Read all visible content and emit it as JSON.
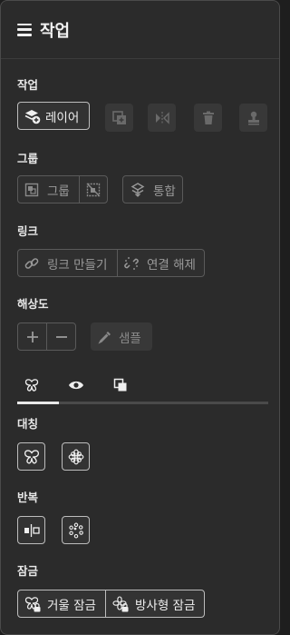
{
  "header": {
    "title": "작업"
  },
  "sections": {
    "work": {
      "label": "작업",
      "layer_button": "레이어"
    },
    "group": {
      "label": "그룹",
      "group_button": "그룹",
      "merge_button": "통합"
    },
    "link": {
      "label": "링크",
      "make_link_button": "링크 만들기",
      "unlink_button": "연결 해제"
    },
    "resolution": {
      "label": "해상도",
      "sample_button": "샘플"
    },
    "tabs": {
      "items": [
        "symmetry-tab",
        "visibility-tab",
        "layers-tab"
      ],
      "selected": 0
    },
    "symmetry": {
      "label": "대칭"
    },
    "repeat": {
      "label": "반복"
    },
    "lock": {
      "label": "잠금",
      "mirror_lock_button": "거울 잠금",
      "radial_lock_button": "방사형 잠금"
    }
  },
  "colors": {
    "panel_bg": "#2b2b2b",
    "border_active": "#bdbdbd",
    "border_inactive": "#5a5a5a",
    "text": "#e8e8e8"
  }
}
